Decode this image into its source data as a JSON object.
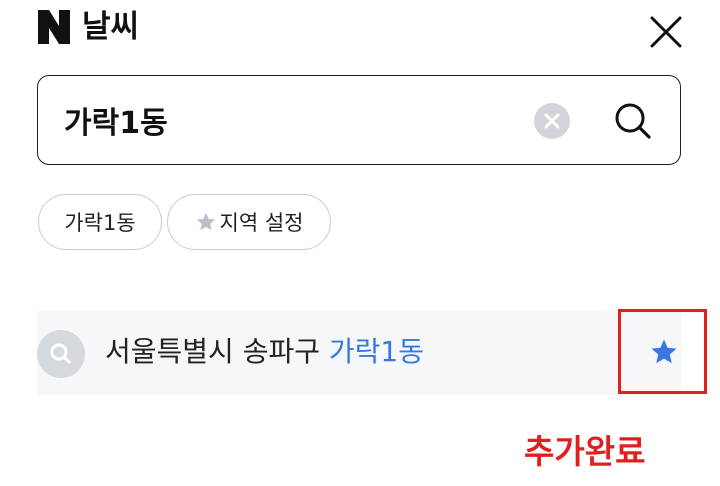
{
  "header": {
    "logo_icon": "naver-n-logo",
    "title": "날씨",
    "close_icon": "close-icon"
  },
  "search": {
    "value": "가락1동",
    "clear_icon": "clear-icon",
    "search_icon": "search-icon"
  },
  "chips": [
    {
      "label": "가락1동"
    },
    {
      "label": "지역 설정",
      "icon": "star-icon"
    }
  ],
  "result": {
    "icon": "search-icon",
    "prefix": "서울특별시 송파구 ",
    "highlight": "가락1동",
    "favorite_icon": "star-icon",
    "favorited": true
  },
  "notice": "추가완료",
  "colors": {
    "accent_blue": "#3a76e0",
    "highlight_red": "#e02020",
    "row_background": "#f6f7f9"
  }
}
